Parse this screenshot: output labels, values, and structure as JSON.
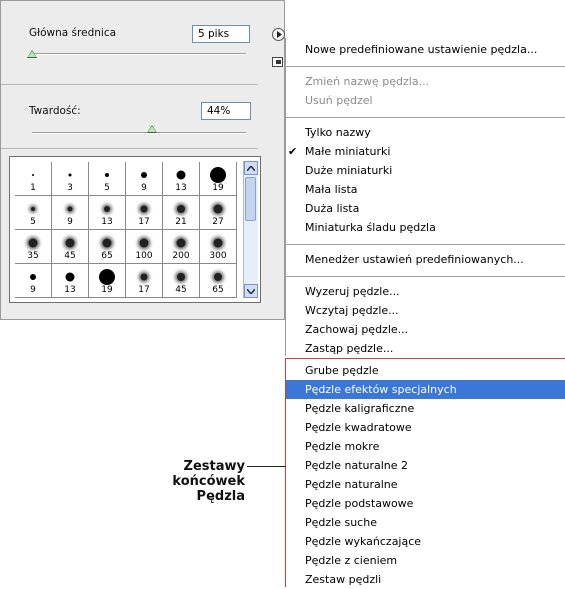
{
  "panel": {
    "diameter_label": "Główna średnica",
    "diameter_value": "5 piks",
    "diameter_slider": 0.0,
    "hardness_label": "Twardość:",
    "hardness_value": "44%",
    "hardness_slider": 0.44,
    "brushes": [
      {
        "size": "1",
        "dot": 2,
        "soft": false
      },
      {
        "size": "3",
        "dot": 3,
        "soft": false
      },
      {
        "size": "5",
        "dot": 4,
        "soft": false
      },
      {
        "size": "9",
        "dot": 6,
        "soft": false
      },
      {
        "size": "13",
        "dot": 9,
        "soft": false
      },
      {
        "size": "19",
        "dot": 16,
        "soft": false
      },
      {
        "size": "5",
        "dot": 4,
        "soft": true
      },
      {
        "size": "9",
        "dot": 5,
        "soft": true
      },
      {
        "size": "13",
        "dot": 6,
        "soft": true
      },
      {
        "size": "17",
        "dot": 7,
        "soft": true
      },
      {
        "size": "21",
        "dot": 8,
        "soft": true
      },
      {
        "size": "27",
        "dot": 9,
        "soft": true
      },
      {
        "size": "35",
        "dot": 9,
        "soft": true
      },
      {
        "size": "45",
        "dot": 9,
        "soft": true
      },
      {
        "size": "65",
        "dot": 9,
        "soft": true
      },
      {
        "size": "100",
        "dot": 9,
        "soft": true
      },
      {
        "size": "200",
        "dot": 9,
        "soft": true
      },
      {
        "size": "300",
        "dot": 9,
        "soft": true
      },
      {
        "size": "9",
        "dot": 6,
        "soft": false
      },
      {
        "size": "13",
        "dot": 9,
        "soft": false
      },
      {
        "size": "19",
        "dot": 16,
        "soft": false
      },
      {
        "size": "17",
        "dot": 7,
        "soft": true
      },
      {
        "size": "45",
        "dot": 8,
        "soft": true
      },
      {
        "size": "65",
        "dot": 8,
        "soft": true
      }
    ]
  },
  "menu": {
    "groups": [
      [
        {
          "label": "Nowe predefiniowane ustawienie pędzla...",
          "disabled": false
        }
      ],
      [
        {
          "label": "Zmień nazwę pędzla...",
          "disabled": true
        },
        {
          "label": "Usuń pędzel",
          "disabled": true
        }
      ],
      [
        {
          "label": "Tylko nazwy",
          "disabled": false
        },
        {
          "label": "Małe miniaturki",
          "disabled": false,
          "checked": true
        },
        {
          "label": "Duże miniaturki",
          "disabled": false
        },
        {
          "label": "Mała lista",
          "disabled": false
        },
        {
          "label": "Duża lista",
          "disabled": false
        },
        {
          "label": "Miniaturka śladu pędzla",
          "disabled": false
        }
      ],
      [
        {
          "label": "Menedżer ustawień predefiniowanych...",
          "disabled": false
        }
      ],
      [
        {
          "label": "Wyzeruj pędzle...",
          "disabled": false
        },
        {
          "label": "Wczytaj pędzle...",
          "disabled": false
        },
        {
          "label": "Zachowaj pędzle...",
          "disabled": false
        },
        {
          "label": "Zastąp pędzle...",
          "disabled": false
        }
      ]
    ],
    "brush_sets": [
      "Grube pędzle",
      "Pędzle efektów specjalnych",
      "Pędzle kaligraficzne",
      "Pędzle kwadratowe",
      "Pędzle mokre",
      "Pędzle naturalne 2",
      "Pędzle naturalne",
      "Pędzle podstawowe",
      "Pędzle suche",
      "Pędzle wykańczające",
      "Pędzle z cieniem",
      "Zestaw pędzli"
    ],
    "highlighted_index": 1
  },
  "callout": {
    "line1": "Zestawy",
    "line2": "końcówek",
    "line3": "Pędzla"
  },
  "colors": {
    "highlight": "#3a77d6",
    "callout_border": "#d63b3b"
  }
}
